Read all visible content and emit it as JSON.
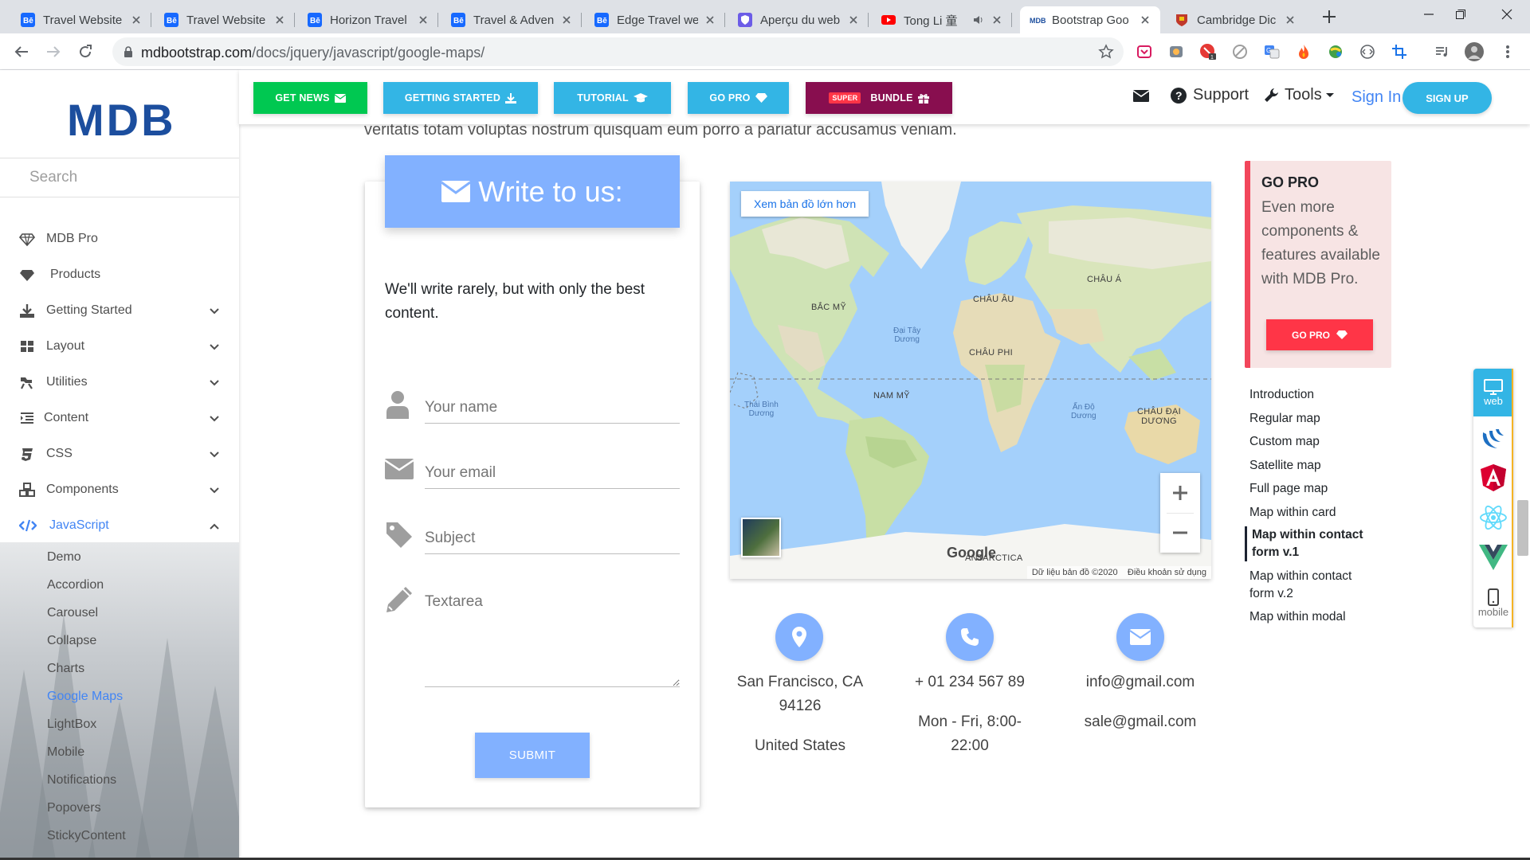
{
  "browser": {
    "tabs": [
      {
        "title": "Travel Website",
        "favicon": "behance-icon",
        "active": false
      },
      {
        "title": "Travel Website",
        "favicon": "behance-icon",
        "active": false
      },
      {
        "title": "Horizon Travel",
        "favicon": "behance-icon",
        "active": false
      },
      {
        "title": "Travel & Adven",
        "favicon": "behance-icon",
        "active": false
      },
      {
        "title": "Edge Travel we",
        "favicon": "behance-icon",
        "active": false
      },
      {
        "title": "Aperçu du web",
        "favicon": "shield-icon",
        "active": false
      },
      {
        "title": "Tong Li 童",
        "favicon": "youtube-icon",
        "active": false
      },
      {
        "title": "Bootstrap Goo",
        "favicon": "mdb-icon",
        "active": true
      },
      {
        "title": "Cambridge Dic",
        "favicon": "cambridge-icon",
        "active": false
      }
    ],
    "url_host": "mdbootstrap.com",
    "url_path": "/docs/jquery/javascript/google-maps/"
  },
  "sidebar": {
    "logo": "MDB",
    "search_placeholder": "Search",
    "menu": [
      {
        "label": "MDB Pro",
        "icon": "diamond-icon",
        "expandable": false
      },
      {
        "label": "Products",
        "icon": "gem-icon",
        "expandable": false
      },
      {
        "label": "Getting Started",
        "icon": "download-icon",
        "expandable": true
      },
      {
        "label": "Layout",
        "icon": "grid-icon",
        "expandable": true
      },
      {
        "label": "Utilities",
        "icon": "tools-icon",
        "expandable": true
      },
      {
        "label": "Content",
        "icon": "list-icon",
        "expandable": true
      },
      {
        "label": "CSS",
        "icon": "css-icon",
        "expandable": true
      },
      {
        "label": "Components",
        "icon": "cubes-icon",
        "expandable": true
      },
      {
        "label": "JavaScript",
        "icon": "code-icon",
        "expandable": true,
        "active": true
      }
    ],
    "submenu": [
      "Demo",
      "Accordion",
      "Carousel",
      "Collapse",
      "Charts",
      "Google Maps",
      "LightBox",
      "Mobile",
      "Notifications",
      "Popovers",
      "StickyContent"
    ],
    "submenu_active": "Google Maps"
  },
  "topbar": {
    "buttons": [
      {
        "label": "GET NEWS",
        "color": "#00c851"
      },
      {
        "label": "GETTING STARTED",
        "color": "#33b5e5"
      },
      {
        "label": "TUTORIAL",
        "color": "#33b5e5"
      },
      {
        "label": "GO PRO",
        "color": "#33b5e5"
      },
      {
        "label": "BUNDLE",
        "badge": "SUPER",
        "color": "#880e4f"
      }
    ],
    "support": "Support",
    "tools": "Tools",
    "signin": "Sign In",
    "signup": "SIGN UP"
  },
  "content": {
    "cut_text": "veritatis totam voluptas nostrum quisquam eum porro a pariatur accusamus veniam.",
    "form": {
      "title": "Write to us:",
      "intro": "We'll write rarely, but with only the best content.",
      "name_placeholder": "Your name",
      "email_placeholder": "Your email",
      "subject_placeholder": "Subject",
      "textarea_placeholder": "Textarea",
      "submit": "SUBMIT"
    },
    "map": {
      "larger_map_link": "Xem bản đồ lớn hơn",
      "labels": {
        "north_america": "BẮC MỸ",
        "europe": "CHÂU ÂU",
        "asia": "CHÂU Á",
        "africa": "CHÂU PHI",
        "south_america": "NAM MỸ",
        "oceania_1": "CHÂU ĐẠI",
        "oceania_2": "DƯƠNG",
        "antarctica": "ANTARCTICA",
        "atlantic_1": "Đại Tây",
        "atlantic_2": "Dương",
        "pacific_1": "Thái Bình",
        "pacific_2": "Dương",
        "indian_1": "Ấn Độ",
        "indian_2": "Dương"
      },
      "google": "Google",
      "data_credit": "Dữ liệu bản đồ ©2020",
      "terms": "Điều khoản sử dụng"
    },
    "contacts": {
      "address_1": "San Francisco, CA",
      "address_2": "94126",
      "address_3": "United States",
      "phone": "+ 01 234 567 89",
      "hours_1": "Mon - Fri, 8:00-",
      "hours_2": "22:00",
      "email_1": "info@gmail.com",
      "email_2": "sale@gmail.com"
    }
  },
  "right": {
    "gopro_title": "GO PRO",
    "gopro_text": "Even more components & features available with MDB Pro.",
    "gopro_button": "GO PRO",
    "toc": [
      {
        "label": "Introduction",
        "active": false
      },
      {
        "label": "Regular map",
        "active": false
      },
      {
        "label": "Custom map",
        "active": false
      },
      {
        "label": "Satellite map",
        "active": false
      },
      {
        "label": "Full page map",
        "active": false
      },
      {
        "label": "Map within card",
        "active": false
      },
      {
        "label": "Map within contact form v.1",
        "active": true
      },
      {
        "label": "Map within contact form v.2",
        "active": false
      },
      {
        "label": "Map within modal",
        "active": false
      }
    ]
  },
  "floating": {
    "web": "web",
    "mobile": "mobile"
  }
}
